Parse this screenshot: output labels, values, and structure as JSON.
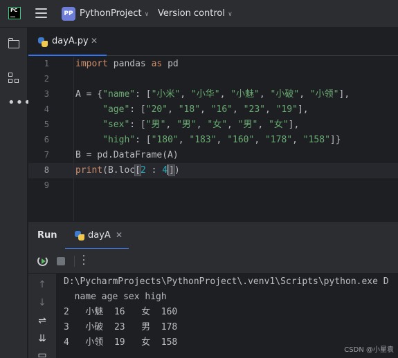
{
  "topbar": {
    "logo": "PC",
    "project_badge": "PP",
    "project_name": "PythonProject",
    "vcs_label": "Version control"
  },
  "editor_tab": {
    "file_name": "dayA.py"
  },
  "editor": {
    "line_numbers": [
      "1",
      "2",
      "3",
      "4",
      "5",
      "6",
      "7",
      "8",
      "9"
    ],
    "current_line": 8,
    "lines": [
      "import pandas as pd",
      "",
      "A = {\"name\": [\"小米\", \"小华\", \"小魅\", \"小破\", \"小领\"],",
      "     \"age\": [\"20\", \"18\", \"16\", \"23\", \"19\"],",
      "     \"sex\": [\"男\", \"男\", \"女\", \"男\", \"女\"],",
      "     \"high\": [\"180\", \"183\", \"160\", \"178\", \"158\"]}",
      "B = pd.DataFrame(A)",
      "print(B.loc[2 : 4])",
      ""
    ]
  },
  "run_panel": {
    "title": "Run",
    "tab_name": "dayA",
    "console_lines": [
      "D:\\PycharmProjects\\PythonProject\\.venv1\\Scripts\\python.exe D",
      "  name age sex high",
      "2   小魅  16   女  160",
      "3   小破  23   男  178",
      "4   小领  19   女  158"
    ]
  },
  "watermark": "CSDN @小星袁",
  "colors": {
    "background": "#1e1f22",
    "panel": "#2b2d30",
    "accent": "#3574f0",
    "keyword": "#cf8e6d",
    "string": "#6aab73",
    "number": "#2aacb8"
  }
}
